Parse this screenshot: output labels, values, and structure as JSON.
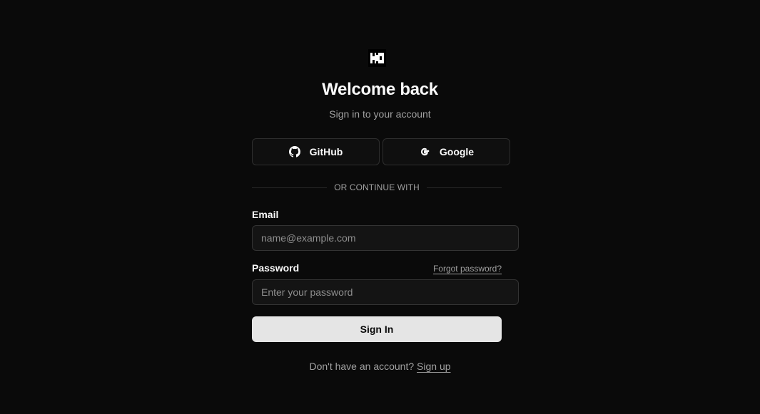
{
  "header": {
    "logo_icon": "brand-logo-icon",
    "title": "Welcome back",
    "subtitle": "Sign in to your account"
  },
  "oauth": {
    "github_label": "GitHub",
    "github_icon": "github-icon",
    "google_label": "Google",
    "google_icon": "google-icon"
  },
  "divider": {
    "text": "OR CONTINUE WITH"
  },
  "form": {
    "email_label": "Email",
    "email_value": "",
    "email_placeholder": "name@example.com",
    "password_label": "Password",
    "password_value": "",
    "password_placeholder": "Enter your password",
    "forgot_label": "Forgot password?",
    "submit_label": "Sign In"
  },
  "footer": {
    "prompt": "Don't have an account?",
    "signup_label": "Sign up"
  },
  "colors": {
    "background": "#0a0a0a",
    "primary_button": "#e5e5e5",
    "border": "#2e2e2e",
    "muted_text": "#a1a1a1"
  }
}
